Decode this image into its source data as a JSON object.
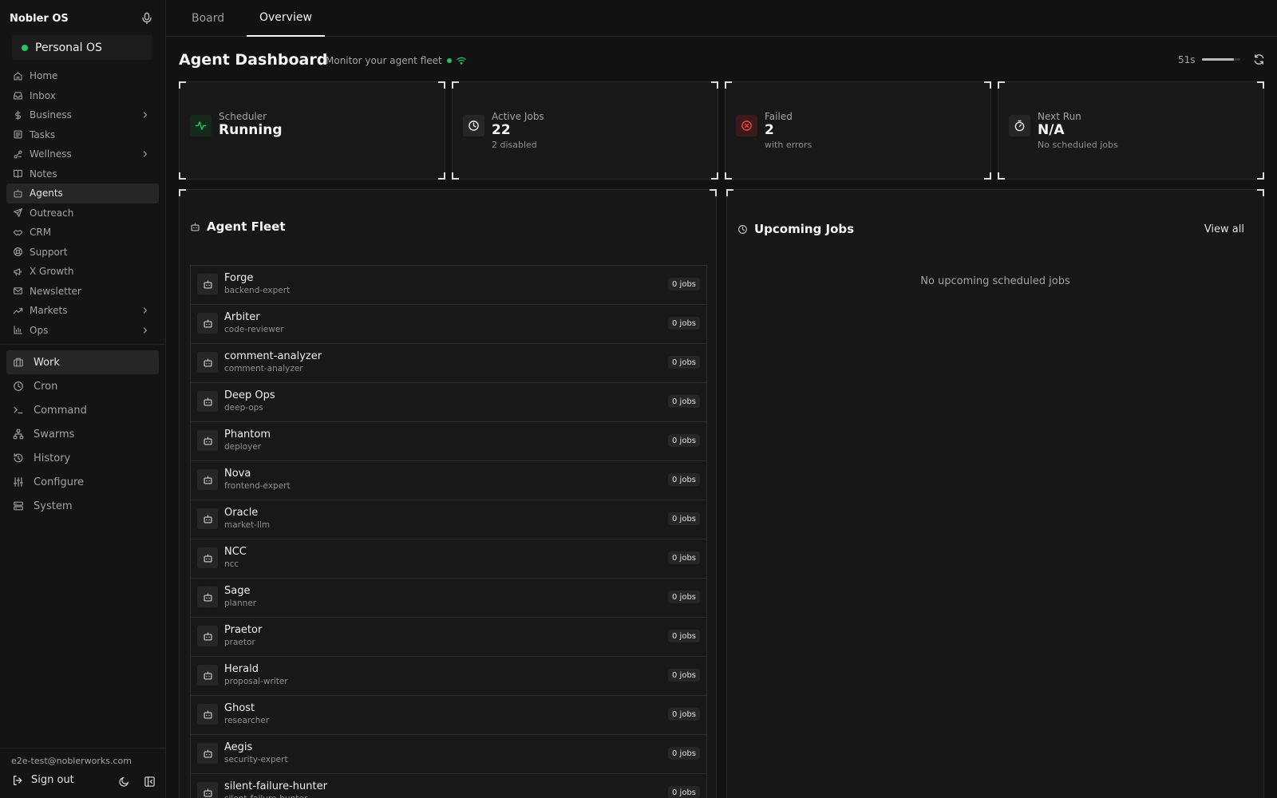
{
  "app": {
    "brand": "Nobler OS",
    "workspace": "Personal OS"
  },
  "sidebar": {
    "items": [
      {
        "label": "Home",
        "icon": "home-icon"
      },
      {
        "label": "Inbox",
        "icon": "inbox-icon"
      },
      {
        "label": "Business",
        "icon": "dollar-icon",
        "has_children": true
      },
      {
        "label": "Tasks",
        "icon": "tasks-icon"
      },
      {
        "label": "Wellness",
        "icon": "wellness-icon",
        "has_children": true
      },
      {
        "label": "Notes",
        "icon": "book-icon"
      },
      {
        "label": "Agents",
        "icon": "bot-icon",
        "active": true
      },
      {
        "label": "Outreach",
        "icon": "send-icon"
      },
      {
        "label": "CRM",
        "icon": "handshake-icon"
      },
      {
        "label": "Support",
        "icon": "lifebuoy-icon"
      },
      {
        "label": "X Growth",
        "icon": "megaphone-icon"
      },
      {
        "label": "Newsletter",
        "icon": "mail-icon"
      },
      {
        "label": "Markets",
        "icon": "trending-icon",
        "has_children": true
      },
      {
        "label": "Ops",
        "icon": "bar-chart-icon",
        "has_children": true
      }
    ],
    "work_items": [
      {
        "label": "Work",
        "icon": "briefcase-icon",
        "active": true
      },
      {
        "label": "Cron",
        "icon": "clock-icon"
      },
      {
        "label": "Command",
        "icon": "terminal-icon"
      },
      {
        "label": "Swarms",
        "icon": "network-icon"
      },
      {
        "label": "History",
        "icon": "history-icon"
      },
      {
        "label": "Configure",
        "icon": "sliders-icon"
      },
      {
        "label": "System",
        "icon": "server-icon"
      }
    ],
    "user_email": "e2e-test@noblerworks.com",
    "sign_out": "Sign out"
  },
  "tabs": [
    {
      "label": "Board"
    },
    {
      "label": "Overview",
      "active": true
    }
  ],
  "header": {
    "title": "Agent Dashboard",
    "subtitle": "Monitor your agent fleet",
    "refresh_timer": "51s",
    "refresh_progress": 0.85
  },
  "stats": [
    {
      "label": "Scheduler",
      "value": "Running",
      "sub": "",
      "icon": "activity-icon",
      "accent": "#22c55e"
    },
    {
      "label": "Active Jobs",
      "value": "22",
      "sub": "2 disabled",
      "icon": "clock-icon",
      "accent": "#e5e5e5"
    },
    {
      "label": "Failed",
      "value": "2",
      "sub": "with errors",
      "icon": "x-circle-icon",
      "accent": "#ef4444"
    },
    {
      "label": "Next Run",
      "value": "N/A",
      "sub": "No scheduled jobs",
      "icon": "timer-icon",
      "accent": "#e5e5e5"
    }
  ],
  "fleet": {
    "title": "Agent Fleet",
    "agents": [
      {
        "name": "Forge",
        "role": "backend-expert",
        "jobs": "0 jobs"
      },
      {
        "name": "Arbiter",
        "role": "code-reviewer",
        "jobs": "0 jobs"
      },
      {
        "name": "comment-analyzer",
        "role": "comment-analyzer",
        "jobs": "0 jobs"
      },
      {
        "name": "Deep Ops",
        "role": "deep-ops",
        "jobs": "0 jobs"
      },
      {
        "name": "Phantom",
        "role": "deployer",
        "jobs": "0 jobs"
      },
      {
        "name": "Nova",
        "role": "frontend-expert",
        "jobs": "0 jobs"
      },
      {
        "name": "Oracle",
        "role": "market-llm",
        "jobs": "0 jobs"
      },
      {
        "name": "NCC",
        "role": "ncc",
        "jobs": "0 jobs"
      },
      {
        "name": "Sage",
        "role": "planner",
        "jobs": "0 jobs"
      },
      {
        "name": "Praetor",
        "role": "praetor",
        "jobs": "0 jobs"
      },
      {
        "name": "Herald",
        "role": "proposal-writer",
        "jobs": "0 jobs"
      },
      {
        "name": "Ghost",
        "role": "researcher",
        "jobs": "0 jobs"
      },
      {
        "name": "Aegis",
        "role": "security-expert",
        "jobs": "0 jobs"
      },
      {
        "name": "silent-failure-hunter",
        "role": "silent-failure-hunter",
        "jobs": "0 jobs"
      }
    ]
  },
  "upcoming": {
    "title": "Upcoming Jobs",
    "view_all": "View all",
    "empty": "No upcoming scheduled jobs"
  }
}
